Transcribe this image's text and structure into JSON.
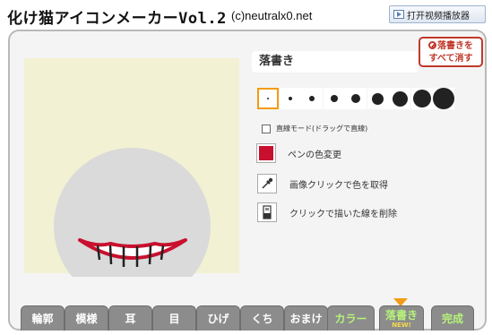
{
  "header": {
    "title": "化け猫アイコンメーカーVol.2",
    "copyright": "(c)neutralx0.net",
    "video_button_label": "打开视频播放器"
  },
  "tool": {
    "name": "落書き",
    "clear_button_line1": "落書きを",
    "clear_button_line2": "すべて消す",
    "brush_sizes": [
      2,
      4,
      6,
      8,
      10,
      13,
      17,
      20,
      24
    ],
    "selected_size_index": 0,
    "straight_line_label": "直線モード(ドラッグで直線)",
    "straight_line_checked": false,
    "pen_color_label": "ペンの色変更",
    "pen_color": "#c8102e",
    "eyedropper_label": "画像クリックで色を取得",
    "erase_label": "クリックで描いた線を削除"
  },
  "tabs": {
    "items": [
      "輪郭",
      "模様",
      "耳",
      "目",
      "ひげ",
      "くち",
      "おまけ"
    ],
    "color": "カラー",
    "draw": "落書き",
    "draw_badge": "NEW!",
    "done": "完成"
  },
  "colors": {
    "canvas_bg": "#f3f1d3",
    "face": "#dadada",
    "accent_red": "#c0392b",
    "tab_text_green": "#b6f27a"
  }
}
